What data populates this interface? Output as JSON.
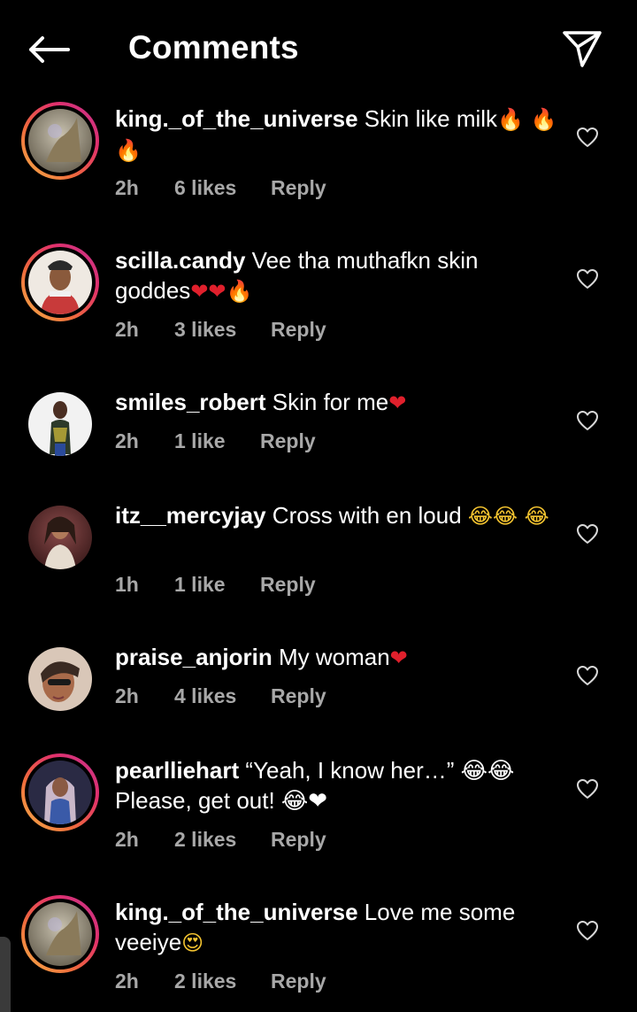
{
  "header": {
    "title": "Comments",
    "back_icon": "arrow-left-icon",
    "send_icon": "paper-plane-icon"
  },
  "comments": [
    {
      "username": "king._of_the_universe",
      "text": "Skin like milk",
      "emoji": "🔥 🔥 🔥",
      "time": "2h",
      "likes": "6 likes",
      "reply": "Reply"
    },
    {
      "username": "scilla.candy",
      "text": "Vee tha muthafkn skin goddes",
      "emoji": "❤❤🔥",
      "time": "2h",
      "likes": "3 likes",
      "reply": "Reply"
    },
    {
      "username": "smiles_robert",
      "text": "Skin for me",
      "emoji": "❤",
      "time": "2h",
      "likes": "1 like",
      "reply": "Reply"
    },
    {
      "username": "itz__mercyjay",
      "text": "Cross with en loud",
      "emoji": "😂😂 😂",
      "time": "1h",
      "likes": "1 like",
      "reply": "Reply"
    },
    {
      "username": "praise_anjorin",
      "text": "My woman",
      "emoji": "❤",
      "time": "2h",
      "likes": "4 likes",
      "reply": "Reply"
    },
    {
      "username": "pearlliehart",
      "text": "“Yeah, I know her…” 😂😂 Please, get out! 😂❤",
      "time": "2h",
      "likes": "2 likes",
      "reply": "Reply"
    },
    {
      "username": "king._of_the_universe",
      "text": "Love me some veeiye",
      "emoji": "😍",
      "time": "2h",
      "likes": "2 likes",
      "reply": "Reply"
    }
  ],
  "colors": {
    "background": "#000000",
    "meta_text": "#a8a8a8",
    "story_ring_start": "#f6b44a",
    "story_ring_end": "#c1358f"
  }
}
